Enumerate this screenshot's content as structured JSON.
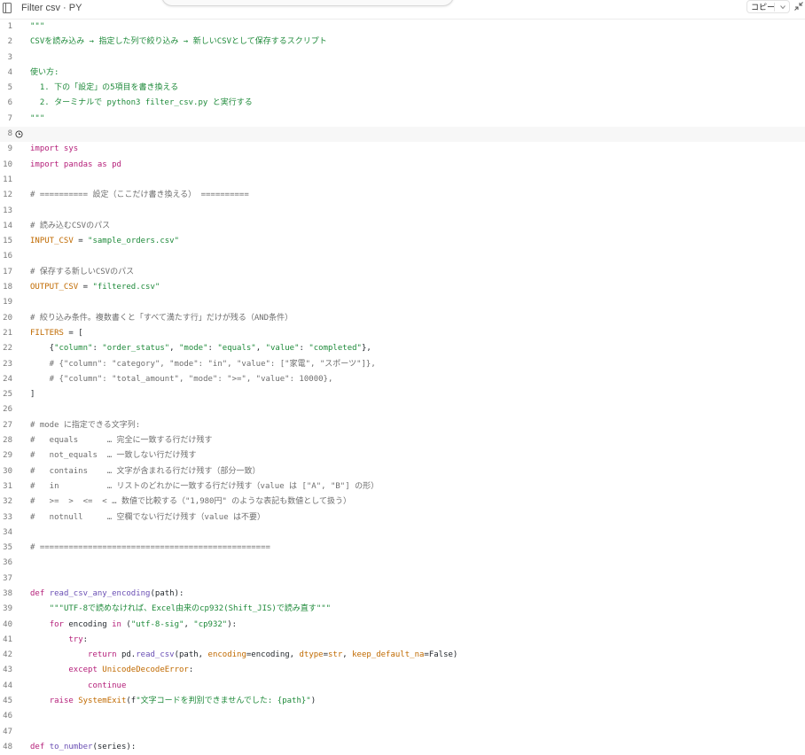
{
  "header": {
    "title": "Filter csv · PY",
    "copy_label": "コピー"
  },
  "colors": {
    "docstring": "#1e8a3a",
    "comment": "#6e6e6e",
    "keyword": "#b5207a",
    "string": "#1e8a3a",
    "number": "#2b5fb8",
    "variable": "#c06a00",
    "function": "#6a4fb4"
  },
  "code": {
    "active_line": 8,
    "lines": [
      [
        [
          "\"\"\"",
          "doc"
        ]
      ],
      [
        [
          "CSVを読み込み → 指定した列で絞り込み → 新しいCSVとして保存するスクリプト",
          "doc"
        ]
      ],
      [],
      [
        [
          "使い方:",
          "doc"
        ]
      ],
      [
        [
          "  1. 下の「設定」の5項目を書き換える",
          "doc"
        ]
      ],
      [
        [
          "  2. ターミナルで python3 filter_csv.py と実行する",
          "doc"
        ]
      ],
      [
        [
          "\"\"\"",
          "doc"
        ]
      ],
      [],
      [
        [
          "import",
          "kw"
        ],
        [
          " sys",
          "kw"
        ]
      ],
      [
        [
          "import",
          "kw"
        ],
        [
          " pandas ",
          "kw"
        ],
        [
          "as",
          "kw"
        ],
        [
          " pd",
          "kw"
        ]
      ],
      [],
      [
        [
          "# ========== 設定（ここだけ書き換える） ==========",
          "com"
        ]
      ],
      [],
      [
        [
          "# 読み込むCSVのパス",
          "com"
        ]
      ],
      [
        [
          "INPUT_CSV",
          "var"
        ],
        [
          " = ",
          "pl"
        ],
        [
          "\"sample_orders.csv\"",
          "str"
        ]
      ],
      [],
      [
        [
          "# 保存する新しいCSVのパス",
          "com"
        ]
      ],
      [
        [
          "OUTPUT_CSV",
          "var"
        ],
        [
          " = ",
          "pl"
        ],
        [
          "\"filtered.csv\"",
          "str"
        ]
      ],
      [],
      [
        [
          "# 絞り込み条件。複数書くと「すべて満たす行」だけが残る（AND条件）",
          "com"
        ]
      ],
      [
        [
          "FILTERS",
          "var"
        ],
        [
          " = [",
          "pl"
        ]
      ],
      [
        [
          "    {",
          "pl"
        ],
        [
          "\"column\"",
          "str"
        ],
        [
          ": ",
          "pl"
        ],
        [
          "\"order_status\"",
          "str"
        ],
        [
          ", ",
          "pl"
        ],
        [
          "\"mode\"",
          "str"
        ],
        [
          ": ",
          "pl"
        ],
        [
          "\"equals\"",
          "str"
        ],
        [
          ", ",
          "pl"
        ],
        [
          "\"value\"",
          "str"
        ],
        [
          ": ",
          "pl"
        ],
        [
          "\"completed\"",
          "str"
        ],
        [
          "},",
          "pl"
        ]
      ],
      [
        [
          "    # {\"column\": \"category\", \"mode\": \"in\", \"value\": [\"家電\", \"スポーツ\"]},",
          "com"
        ]
      ],
      [
        [
          "    # {\"column\": \"total_amount\", \"mode\": \">=\", \"value\": 10000},",
          "com"
        ]
      ],
      [
        [
          "]",
          "pl"
        ]
      ],
      [],
      [
        [
          "# mode に指定できる文字列:",
          "com"
        ]
      ],
      [
        [
          "#   equals      … 完全に一致する行だけ残す",
          "com"
        ]
      ],
      [
        [
          "#   not_equals  … 一致しない行だけ残す",
          "com"
        ]
      ],
      [
        [
          "#   contains    … 文字が含まれる行だけ残す（部分一致）",
          "com"
        ]
      ],
      [
        [
          "#   in          … リストのどれかに一致する行だけ残す（value は [\"A\", \"B\"] の形）",
          "com"
        ]
      ],
      [
        [
          "#   >=  >  <=  < … 数値で比較する（\"1,980円\" のような表記も数値として扱う）",
          "com"
        ]
      ],
      [
        [
          "#   notnull     … 空欄でない行だけ残す（value は不要）",
          "com"
        ]
      ],
      [],
      [
        [
          "# ================================================",
          "com"
        ]
      ],
      [],
      [],
      [
        [
          "def",
          "kw"
        ],
        [
          " ",
          "pl"
        ],
        [
          "read_csv_any_encoding",
          "fn"
        ],
        [
          "(path):",
          "pl"
        ]
      ],
      [
        [
          "    ",
          "pl"
        ],
        [
          "\"\"\"UTF-8で読めなければ、Excel由来のcp932(Shift_JIS)で読み直す\"\"\"",
          "doc"
        ]
      ],
      [
        [
          "    ",
          "pl"
        ],
        [
          "for",
          "kw"
        ],
        [
          " encoding ",
          "pl"
        ],
        [
          "in",
          "kw"
        ],
        [
          " (",
          "pl"
        ],
        [
          "\"utf-8-sig\"",
          "str"
        ],
        [
          ", ",
          "pl"
        ],
        [
          "\"cp932\"",
          "str"
        ],
        [
          "):",
          "pl"
        ]
      ],
      [
        [
          "        ",
          "pl"
        ],
        [
          "try",
          "kw"
        ],
        [
          ":",
          "pl"
        ]
      ],
      [
        [
          "            ",
          "pl"
        ],
        [
          "return",
          "kw"
        ],
        [
          " pd.",
          "pl"
        ],
        [
          "read_csv",
          "fn"
        ],
        [
          "(path, ",
          "pl"
        ],
        [
          "encoding",
          "var"
        ],
        [
          "=encoding, ",
          "pl"
        ],
        [
          "dtype",
          "var"
        ],
        [
          "=",
          "pl"
        ],
        [
          "str",
          "bi"
        ],
        [
          ", ",
          "pl"
        ],
        [
          "keep_default_na",
          "var"
        ],
        [
          "=False)",
          "pl"
        ]
      ],
      [
        [
          "        ",
          "pl"
        ],
        [
          "except",
          "kw"
        ],
        [
          " ",
          "pl"
        ],
        [
          "UnicodeDecodeError",
          "bi"
        ],
        [
          ":",
          "pl"
        ]
      ],
      [
        [
          "            ",
          "pl"
        ],
        [
          "continue",
          "kw"
        ]
      ],
      [
        [
          "    ",
          "pl"
        ],
        [
          "raise",
          "kw"
        ],
        [
          " ",
          "pl"
        ],
        [
          "SystemExit",
          "bi"
        ],
        [
          "(f",
          "pl"
        ],
        [
          "\"文字コードを判別できませんでした: {path}\"",
          "str"
        ],
        [
          ")",
          "pl"
        ]
      ],
      [],
      [],
      [
        [
          "def",
          "kw"
        ],
        [
          " ",
          "pl"
        ],
        [
          "to_number",
          "fn"
        ],
        [
          "(series):",
          "pl"
        ]
      ]
    ]
  }
}
